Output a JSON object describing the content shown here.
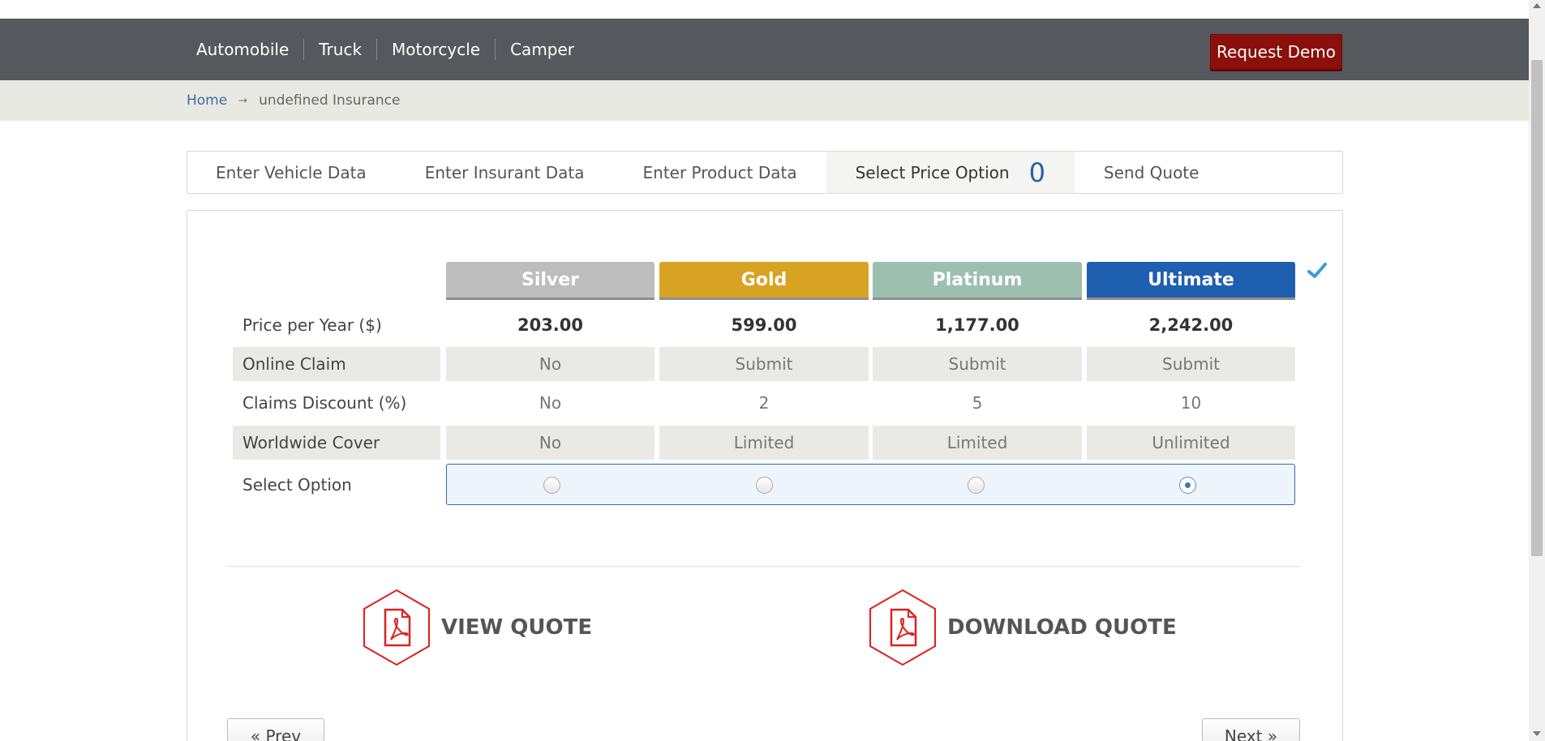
{
  "nav": {
    "items": [
      {
        "label": "Automobile"
      },
      {
        "label": "Truck"
      },
      {
        "label": "Motorcycle"
      },
      {
        "label": "Camper"
      }
    ],
    "demo_button": "Request Demo"
  },
  "breadcrumb": {
    "home": "Home",
    "arrow": "→",
    "current": "undefined Insurance"
  },
  "steps": {
    "items": [
      {
        "label": "Enter Vehicle Data"
      },
      {
        "label": "Enter Insurant Data"
      },
      {
        "label": "Enter Product Data"
      },
      {
        "label": "Select Price Option",
        "count": "0"
      },
      {
        "label": "Send Quote"
      }
    ]
  },
  "pricing": {
    "plans": [
      {
        "name": "Silver",
        "color": "#bdbdbd",
        "price": "203.00",
        "online_claim": "No",
        "claims_discount": "No",
        "worldwide_cover": "No",
        "selected": false
      },
      {
        "name": "Gold",
        "color": "#d8a323",
        "price": "599.00",
        "online_claim": "Submit",
        "claims_discount": "2",
        "worldwide_cover": "Limited",
        "selected": false
      },
      {
        "name": "Platinum",
        "color": "#9dbfb0",
        "price": "1,177.00",
        "online_claim": "Submit",
        "claims_discount": "5",
        "worldwide_cover": "Limited",
        "selected": false
      },
      {
        "name": "Ultimate",
        "color": "#1f5fb0",
        "price": "2,242.00",
        "online_claim": "Submit",
        "claims_discount": "10",
        "worldwide_cover": "Unlimited",
        "selected": true
      }
    ],
    "row_labels": {
      "price": "Price per Year ($)",
      "online_claim": "Online Claim",
      "claims_discount": "Claims Discount (%)",
      "worldwide_cover": "Worldwide Cover",
      "select_option": "Select Option"
    },
    "check_icon": "check-icon"
  },
  "actions": {
    "view_quote": "VIEW QUOTE",
    "download_quote": "DOWNLOAD QUOTE",
    "icon": "pdf-icon",
    "accent_color": "#e02020"
  },
  "pager": {
    "prev": "« Prev",
    "next": "Next »"
  }
}
